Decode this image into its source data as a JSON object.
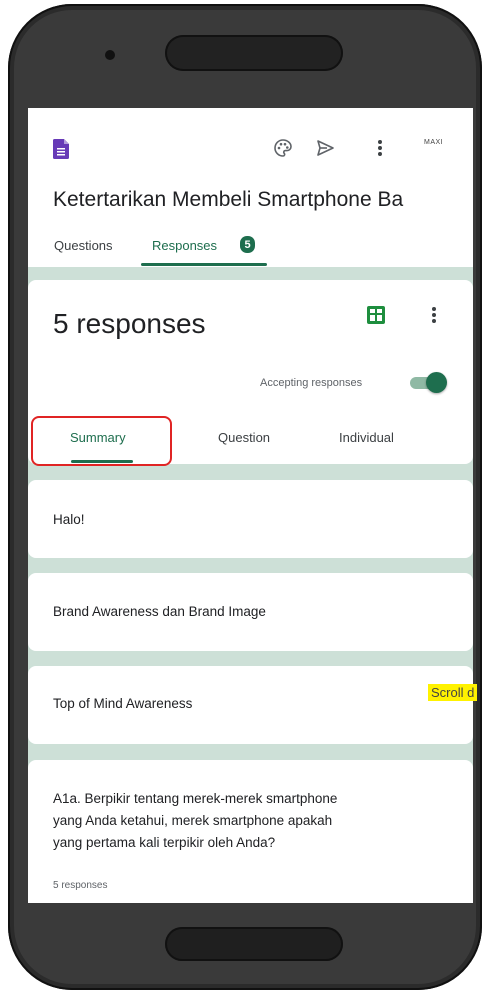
{
  "app": {
    "title": "Ketertarikan Membeli Smartphone Ba",
    "avatar_text": "MAXI"
  },
  "tabs": {
    "questions": "Questions",
    "responses": "Responses",
    "responses_badge": "5"
  },
  "summary_card": {
    "count_text": "5 responses",
    "accepting_label": "Accepting responses",
    "accepting_on": true,
    "subtabs": [
      "Summary",
      "Question",
      "Individual"
    ]
  },
  "sections": [
    {
      "label": "Halo!"
    },
    {
      "label": "Brand Awareness dan Brand Image"
    },
    {
      "label": "Top of Mind Awareness"
    }
  ],
  "question_card": {
    "text": "A1a. Berpikir tentang merek-merek smartphone yang Anda ketahui, merek smartphone apakah yang pertama kali terpikir oleh Anda?",
    "meta": "5 responses"
  },
  "annotation": {
    "scroll_text": "Scroll d"
  },
  "icons": [
    "forms-icon",
    "palette-icon",
    "send-icon",
    "more-vert-icon",
    "sheets-icon"
  ],
  "colors": {
    "accent": "#1e6e4e",
    "background": "#cde0d7",
    "highlight_border": "#e02424",
    "note_bg": "#fff200"
  }
}
